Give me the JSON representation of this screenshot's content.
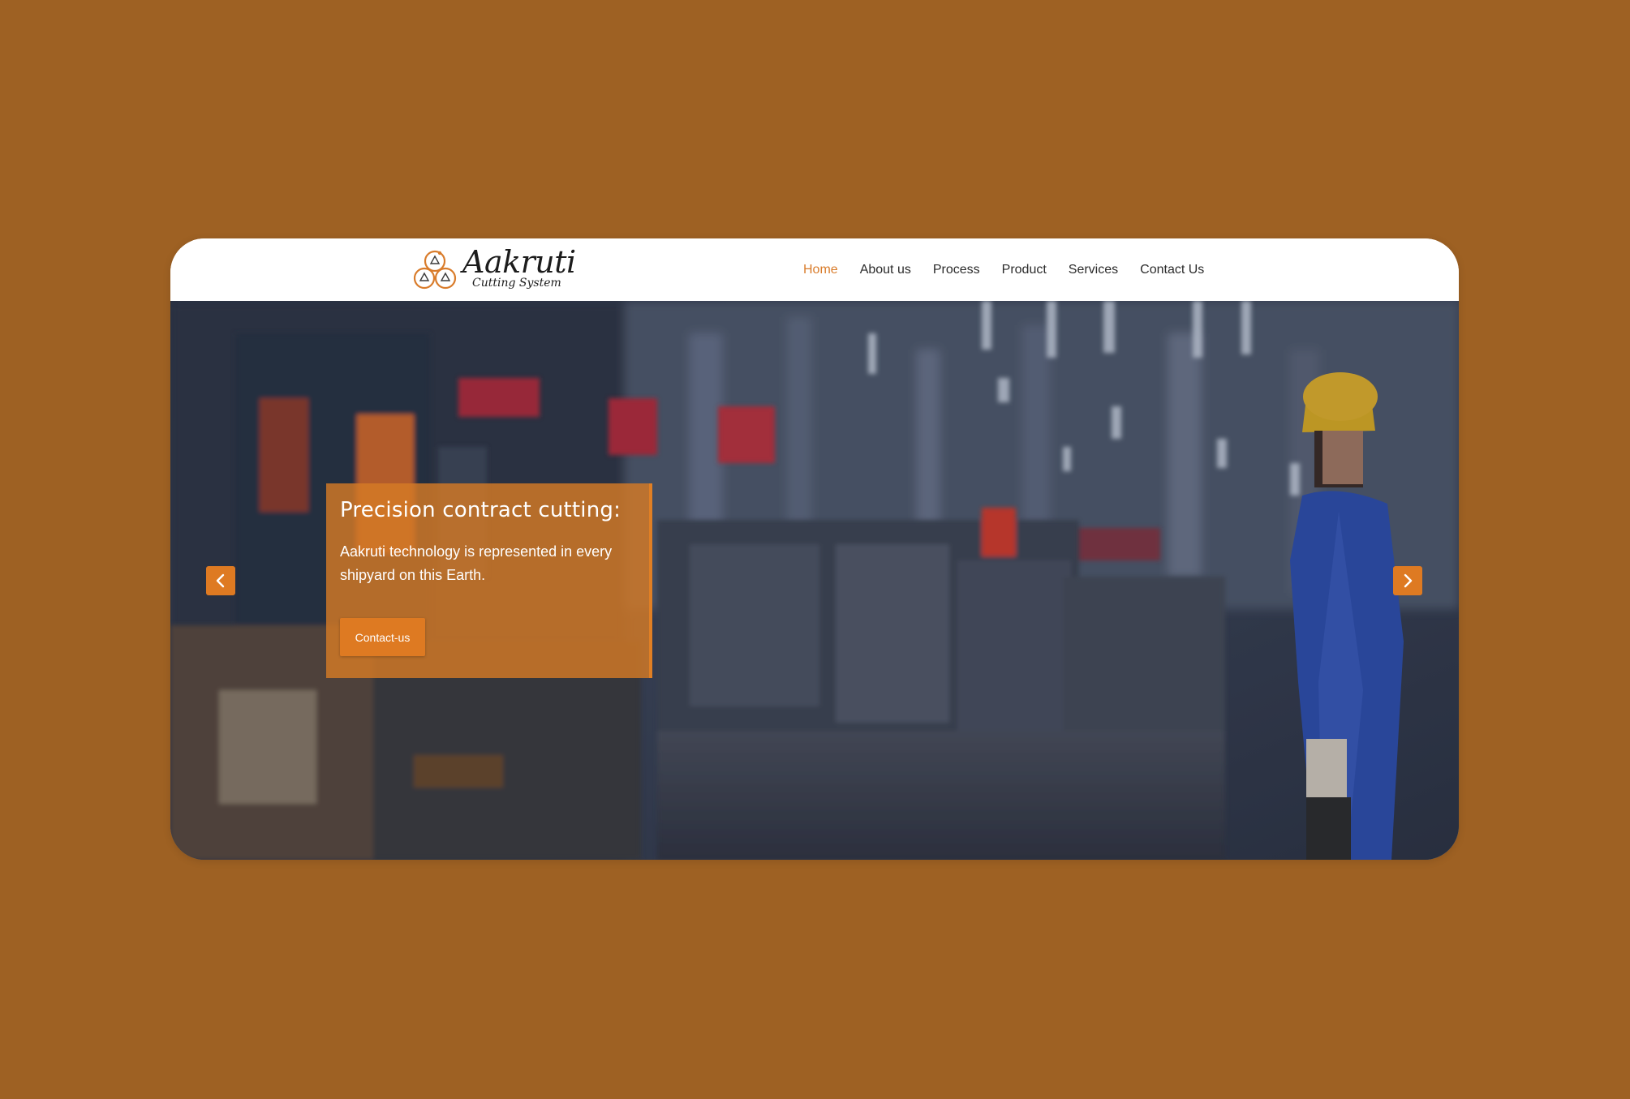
{
  "brand": {
    "name": "Aakruti",
    "tagline": "Cutting System",
    "accent_color": "#DE7A22",
    "background_color": "#9E6123"
  },
  "nav": {
    "items": [
      {
        "label": "Home",
        "active": true
      },
      {
        "label": "About us",
        "active": false
      },
      {
        "label": "Process",
        "active": false
      },
      {
        "label": "Product",
        "active": false
      },
      {
        "label": "Services",
        "active": false
      },
      {
        "label": "Contact Us",
        "active": false
      }
    ]
  },
  "hero": {
    "title": "Precision contract cutting:",
    "text": "Aakruti technology is represented in every shipyard on this Earth.",
    "button_label": "Contact-us",
    "prev_icon": "chevron-left-icon",
    "next_icon": "chevron-right-icon"
  }
}
